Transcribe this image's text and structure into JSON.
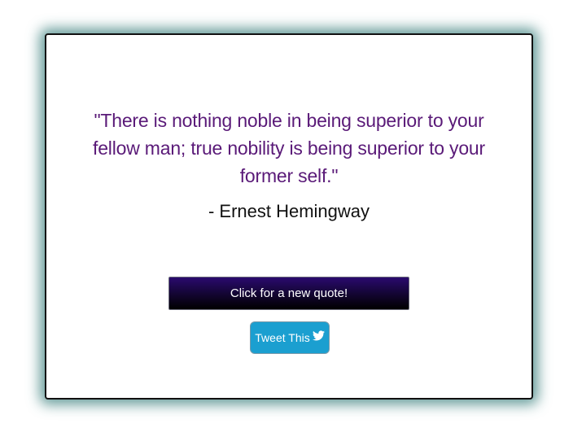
{
  "quote": {
    "text": "\"There is nothing noble in being superior to your fellow man; true nobility is being superior to your former self.\"",
    "author": "- Ernest Hemingway"
  },
  "buttons": {
    "new_quote_label": "Click for a new quote!",
    "tweet_label": "Tweet This",
    "tweet_icon": "twitter-bird-icon"
  },
  "colors": {
    "quote_text": "#5a1a78",
    "card_glow": "#2f7876",
    "new_quote_bg": "#12052f",
    "tweet_bg": "#1b9fd0"
  }
}
